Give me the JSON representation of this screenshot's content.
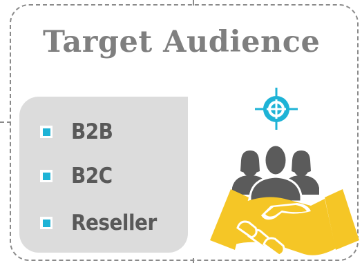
{
  "title": "Target Audience",
  "audience": {
    "items": [
      {
        "label": "B2B"
      },
      {
        "label": "B2C"
      },
      {
        "label": "Reseller"
      }
    ]
  },
  "icons": [
    "crosshair-icon",
    "people-group-icon",
    "handshake-icon"
  ],
  "colors": {
    "title": "#7f7f7f",
    "label": "#595959",
    "panel": "#dcdcdc",
    "accent_blue": "#1eb3d6",
    "people_gray": "#5b5b5b",
    "handshake_yellow": "#f5c626",
    "frame": "#8a8a8a"
  }
}
